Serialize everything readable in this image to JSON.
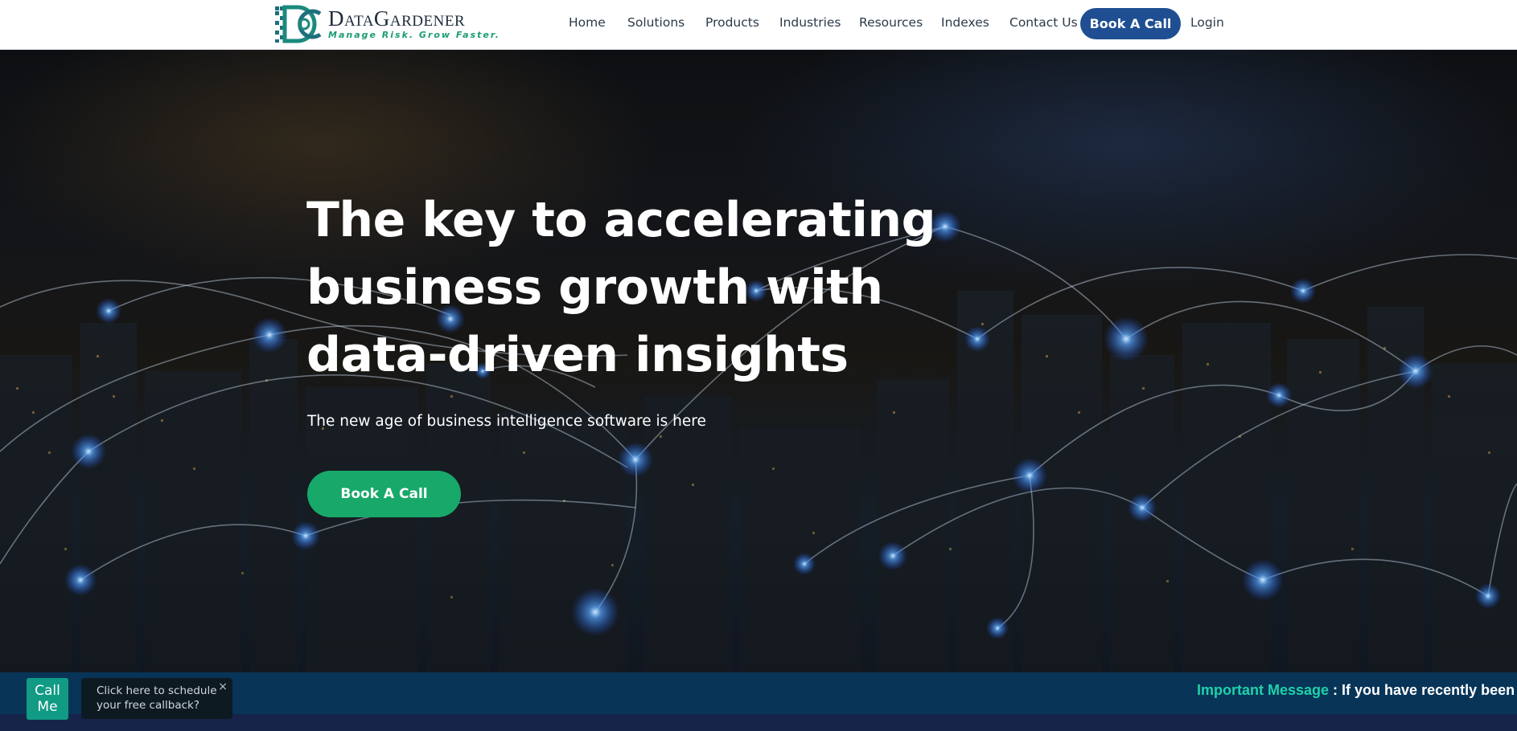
{
  "header": {
    "logo": {
      "name": "DataGardener",
      "tagline": "Manage Risk. Grow Faster."
    },
    "nav": [
      "Home",
      "Solutions",
      "Products",
      "Industries",
      "Resources",
      "Indexes",
      "Contact Us"
    ],
    "book_call": "Book A Call",
    "login": "Login"
  },
  "hero": {
    "title_lines": [
      "The key to accelerating",
      "business growth with",
      "data-driven insights"
    ],
    "subtitle": "The new age of business intelligence software is here",
    "cta": "Book A Call"
  },
  "callback": {
    "button_label": [
      "Call",
      "Me"
    ],
    "tooltip_lines": [
      "Click here to schedule",
      "your free callback?"
    ],
    "close_glyph": "×"
  },
  "announcement": {
    "label": "Important Message",
    "text": " : If you have recently been con"
  },
  "colors": {
    "brand_blue": "#1f4f92",
    "cta_green": "#18a86a",
    "call_teal": "#119a84",
    "highlight_teal": "#1fd1a8",
    "bar_navy": "#083457"
  }
}
